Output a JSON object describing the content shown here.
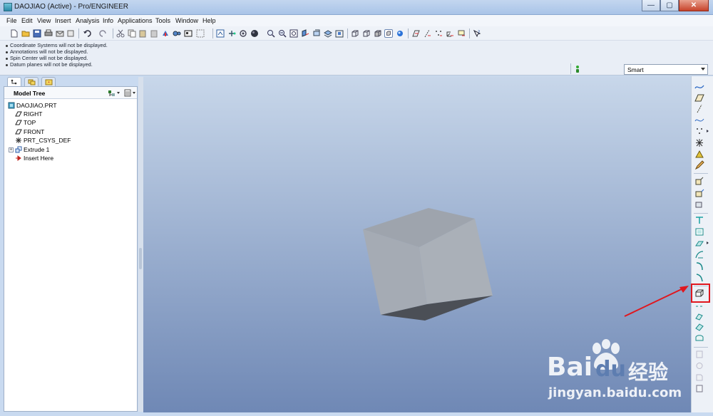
{
  "window": {
    "title": "DAOJIAO (Active) - Pro/ENGINEER",
    "controls": [
      "minimize",
      "maximize",
      "close"
    ],
    "control_glyphs": [
      "—",
      "▢",
      "✕"
    ]
  },
  "menubar": {
    "items": [
      "File",
      "Edit",
      "View",
      "Insert",
      "Analysis",
      "Info",
      "Applications",
      "Tools",
      "Window",
      "Help"
    ]
  },
  "toolbar": {
    "icons": [
      "new-file-icon",
      "open-folder-icon",
      "save-icon",
      "print-icon",
      "email-icon",
      "send-icon",
      "undo-icon",
      "redo-icon",
      "cut-icon",
      "copy-icon",
      "paste-icon",
      "paste-special-icon",
      "regenerate-icon",
      "find-icon",
      "select-box-icon",
      "repaint-icon",
      "spin-center-icon",
      "orient-mode-icon",
      "appearance-icon",
      "zoom-in-icon",
      "zoom-out-icon",
      "refit-icon",
      "reorient-icon",
      "saved-views-icon",
      "layers-icon",
      "shading-icon",
      "wireframe-icon",
      "hidden-line-icon",
      "no-hidden-icon",
      "shaded-icon",
      "enhanced-realism-icon",
      "datum-planes-icon",
      "datum-axes-icon",
      "datum-points-icon",
      "coordinate-systems-icon",
      "context-help-icon"
    ]
  },
  "messages": [
    "Coordinate Systems will not be displayed.",
    "Annotations will not be displayed.",
    "Spin Center will not be displayed.",
    "Datum planes will not be displayed."
  ],
  "filter": {
    "value": "Smart"
  },
  "model_tree": {
    "header": "Model Tree",
    "nodes": [
      {
        "label": "DAOJIAO.PRT",
        "icon": "part-icon"
      },
      {
        "label": "RIGHT",
        "icon": "datum-plane-icon"
      },
      {
        "label": "TOP",
        "icon": "datum-plane-icon"
      },
      {
        "label": "FRONT",
        "icon": "datum-plane-icon"
      },
      {
        "label": "PRT_CSYS_DEF",
        "icon": "coordinate-system-icon"
      },
      {
        "label": "Extrude 1",
        "icon": "extrude-icon"
      },
      {
        "label": "Insert Here",
        "icon": "insert-arrow-icon"
      }
    ]
  },
  "right_toolbar": {
    "icons": [
      "datum-curve-icon",
      "datum-plane-tool-icon",
      "datum-axis-tool-icon",
      "sketched-curve-icon",
      "datum-point-tool-icon",
      "coordinate-system-tool-icon",
      "analysis-tool-icon",
      "sketch-tool-icon",
      "extrude-tool-icon",
      "revolve-tool-icon",
      "sweep-tool-icon",
      "hole-tool-icon",
      "shell-tool-icon",
      "rib-tool-icon",
      "draft-tool-icon",
      "round-tool-icon",
      "chamfer-tool-icon",
      "edge-round-tool-icon",
      "pattern-tool-icon",
      "mirror-tool-icon",
      "merge-tool-icon",
      "trim-tool-icon",
      "offset-tool-icon",
      "thicken-tool-icon",
      "solidify-tool-icon"
    ]
  },
  "watermark": {
    "brand": "Bai",
    "brand2": "du",
    "cn": "经验",
    "url": "jingyan.baidu.com"
  }
}
